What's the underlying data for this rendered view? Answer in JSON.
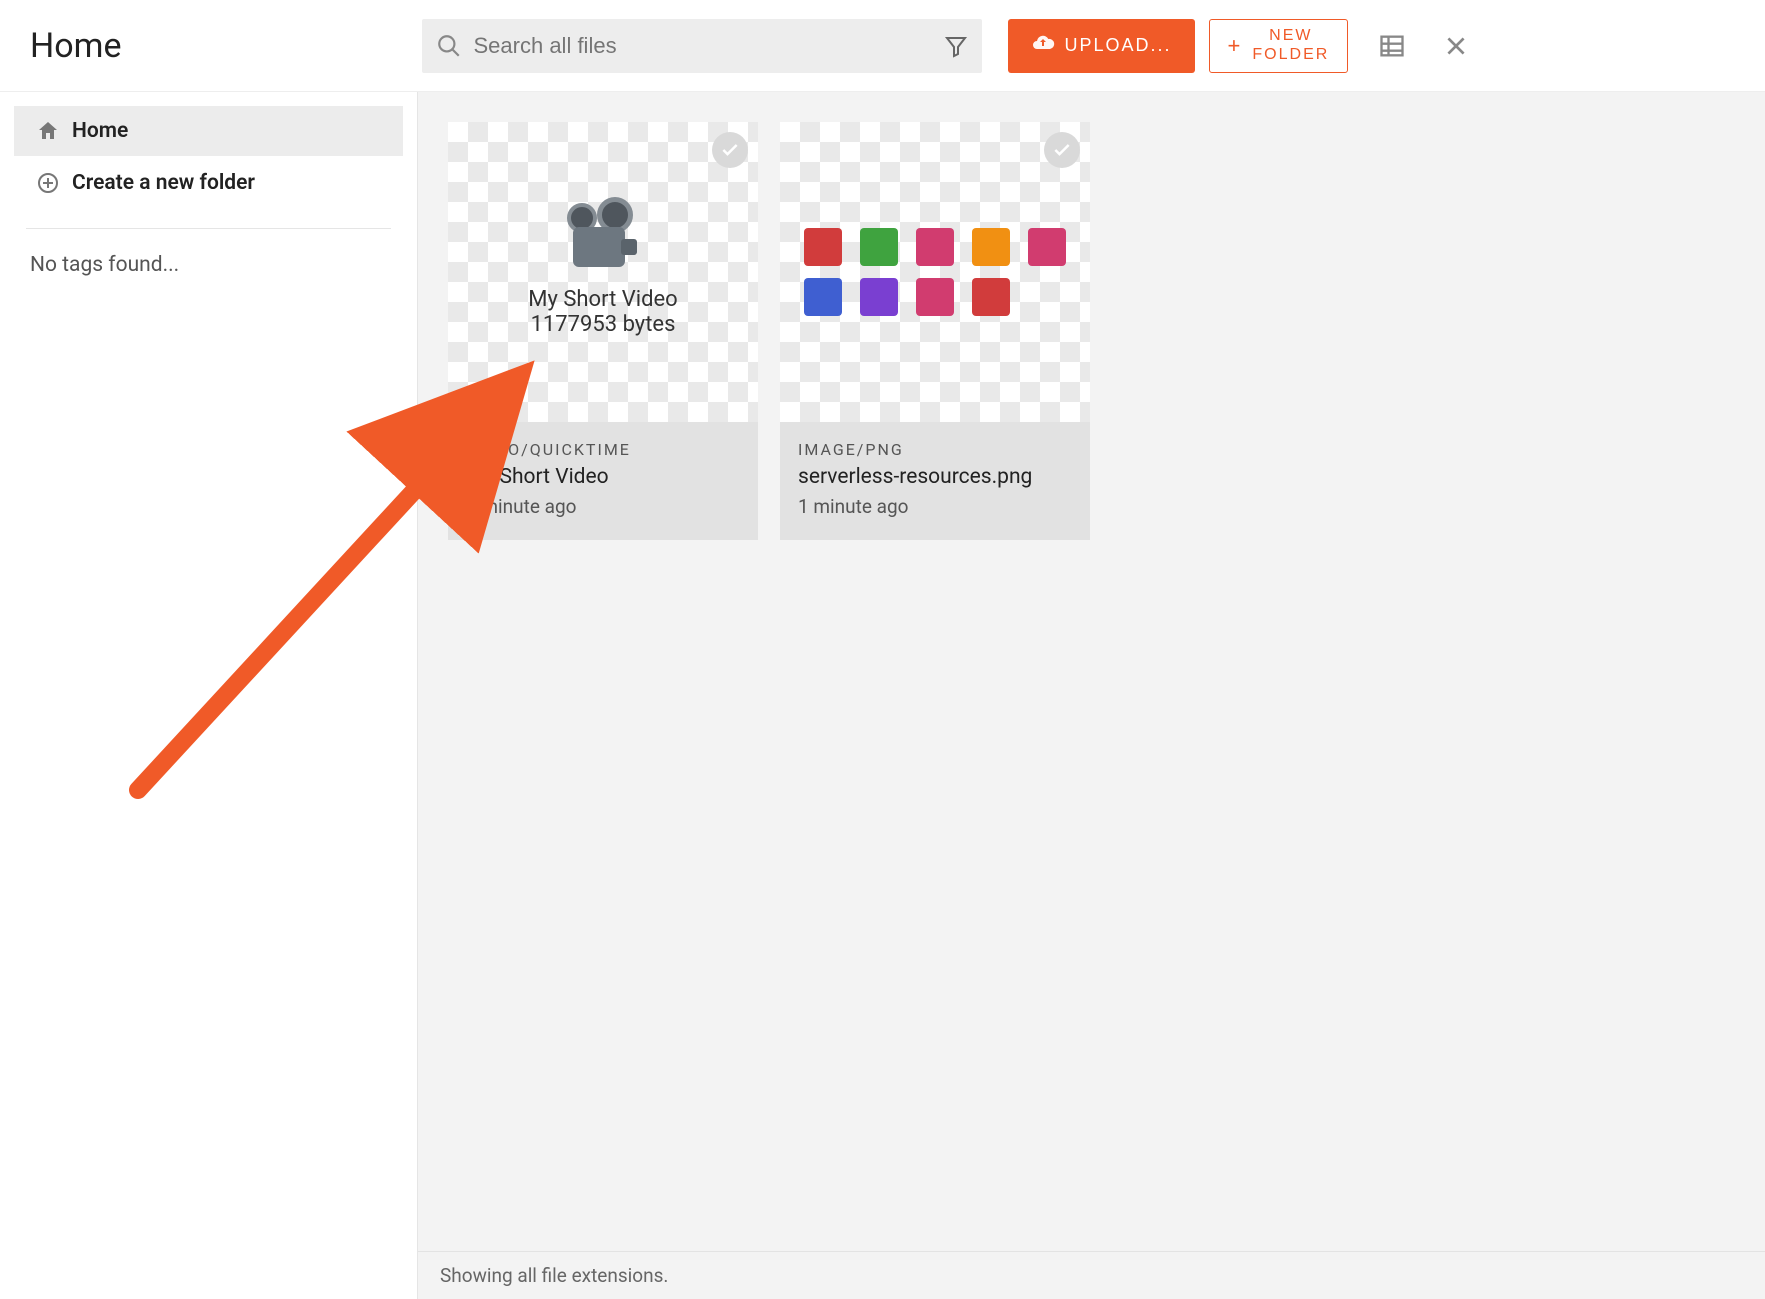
{
  "header": {
    "title": "Home",
    "search_placeholder": "Search all files",
    "upload_label": "UPLOAD...",
    "new_folder_line1": "NEW",
    "new_folder_line2": "FOLDER"
  },
  "sidebar": {
    "home_label": "Home",
    "create_label": "Create a new folder",
    "no_tags": "No tags found..."
  },
  "files": [
    {
      "mime": "VIDEO/QUICKTIME",
      "name": "My Short Video",
      "ago": "1 minute ago",
      "thumb_title": "My Short Video",
      "thumb_bytes": "1177953 bytes"
    },
    {
      "mime": "IMAGE/PNG",
      "name": "serverless-resources.png",
      "ago": "1 minute ago"
    }
  ],
  "status": "Showing all file extensions.",
  "aws_colors": {
    "row1": [
      "#d13c3c",
      "#3fa33f",
      "#d13c6f",
      "#f19012",
      "#d13c6f"
    ],
    "row2": [
      "#3f5fd1",
      "#7a3fd1",
      "#d13c6f",
      "#d13c3c",
      "#ffffff"
    ]
  }
}
